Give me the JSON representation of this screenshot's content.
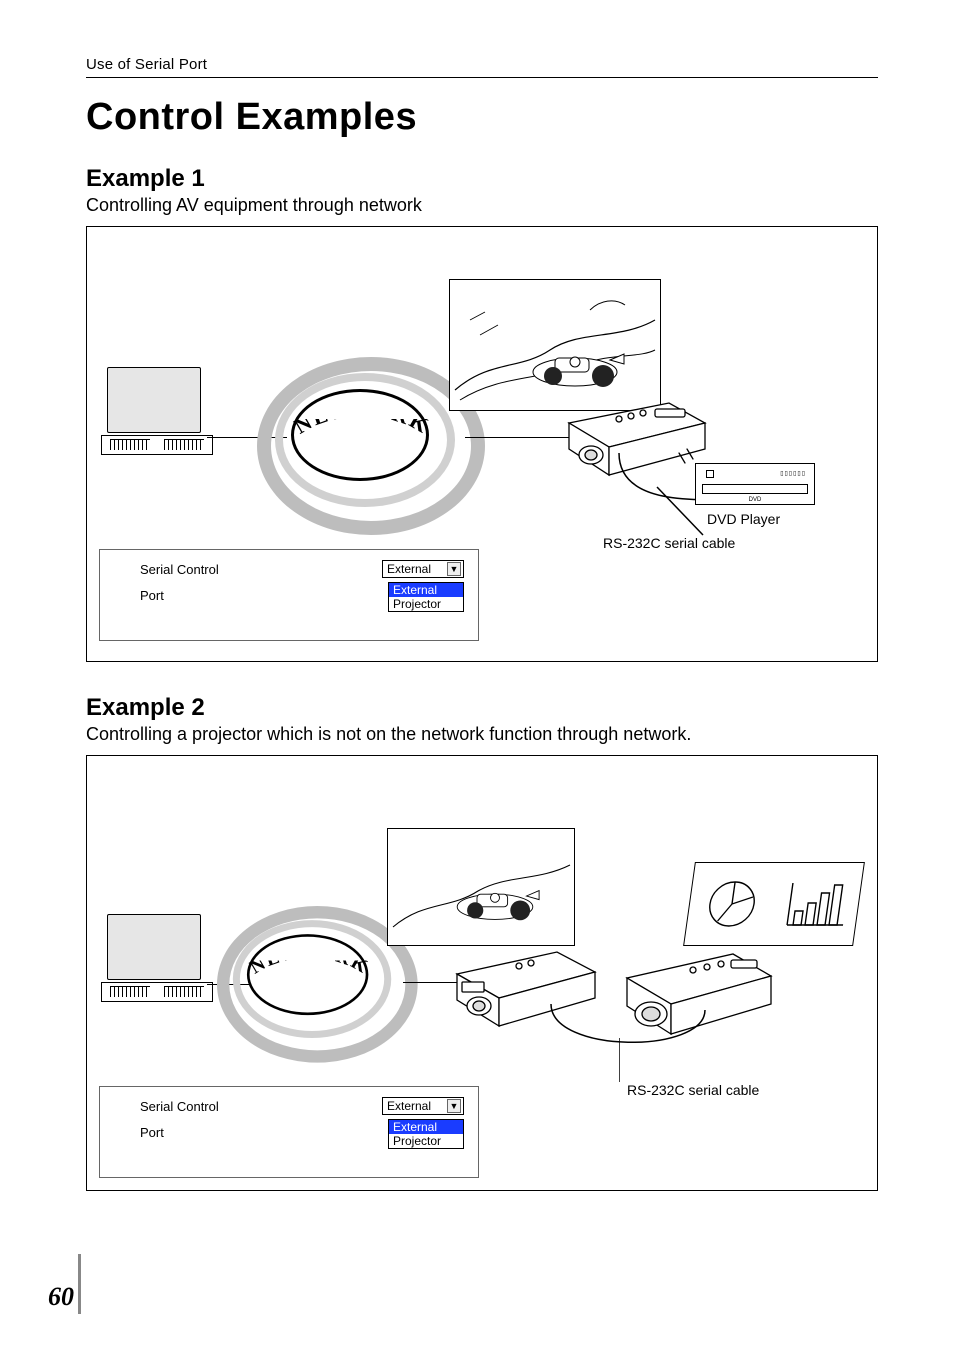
{
  "header": {
    "section": "Use of Serial Port"
  },
  "title": "Control Examples",
  "examples": [
    {
      "heading": "Example 1",
      "description": "Controlling AV equipment through network",
      "network_label": "NETWORK",
      "dvd_label": "DVD Player",
      "cable_label": "RS-232C serial cable",
      "panel": {
        "label1": "Serial Control",
        "label2": "Port",
        "dropdown_value": "External",
        "options": [
          "External",
          "Projector"
        ],
        "selected": "External"
      }
    },
    {
      "heading": "Example 2",
      "description": "Controlling a projector which is not on the network function through network.",
      "network_label": "NETWORK",
      "cable_label": "RS-232C serial cable",
      "panel": {
        "label1": "Serial Control",
        "label2": "Port",
        "dropdown_value": "External",
        "options": [
          "External",
          "Projector"
        ],
        "selected": "External"
      }
    }
  ],
  "page_number": "60"
}
